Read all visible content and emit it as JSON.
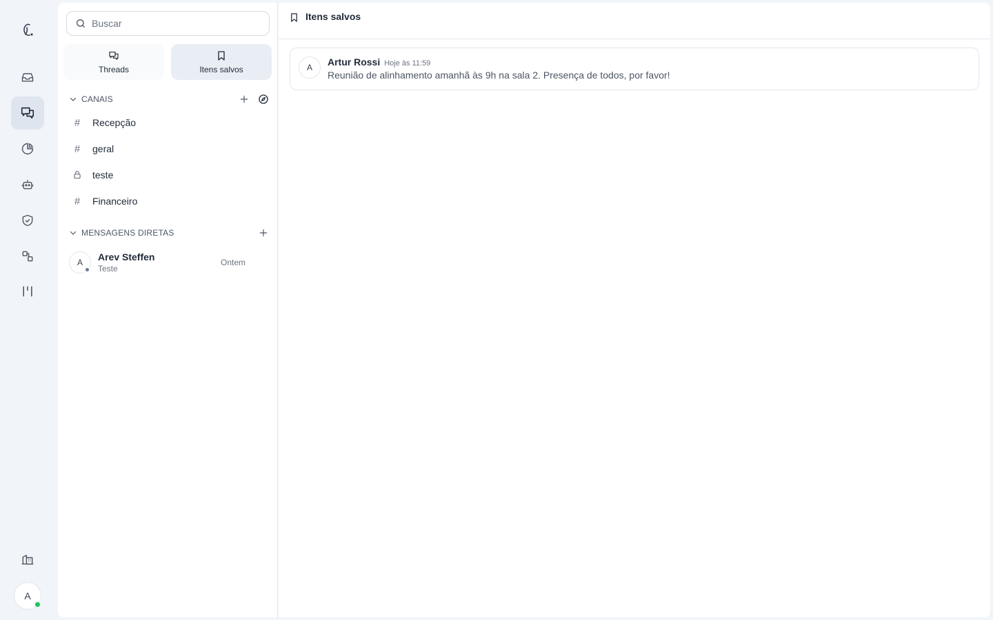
{
  "rail": {
    "items": [
      {
        "name": "logo",
        "icon": "app-logo-icon"
      },
      {
        "name": "inbox",
        "icon": "inbox-icon"
      },
      {
        "name": "chat",
        "icon": "chat-bubbles-icon",
        "active": true
      },
      {
        "name": "reports",
        "icon": "pie-chart-icon"
      },
      {
        "name": "bots",
        "icon": "robot-icon"
      },
      {
        "name": "security",
        "icon": "shield-check-icon"
      },
      {
        "name": "workflows",
        "icon": "workflow-icon"
      },
      {
        "name": "kanban",
        "icon": "kanban-icon"
      },
      {
        "name": "company",
        "icon": "building-icon"
      }
    ],
    "user_initial": "A"
  },
  "sidebar": {
    "search_placeholder": "Buscar",
    "tabs": [
      {
        "label": "Threads",
        "icon": "threads-icon"
      },
      {
        "label": "Itens salvos",
        "icon": "bookmark-icon",
        "active": true
      }
    ],
    "channels_header": "CANAIS",
    "channels": [
      {
        "name": "Recepção",
        "type": "public"
      },
      {
        "name": "geral",
        "type": "public"
      },
      {
        "name": "teste",
        "type": "private"
      },
      {
        "name": "Financeiro",
        "type": "public"
      }
    ],
    "dm_header": "MENSAGENS DIRETAS",
    "dms": [
      {
        "initial": "A",
        "name": "Arev Steffen",
        "preview": "Teste",
        "time": "Ontem"
      }
    ]
  },
  "main": {
    "title": "Itens salvos",
    "saved": [
      {
        "initial": "A",
        "author": "Artur Rossi",
        "time": "Hoje às 11:59",
        "message": "Reunião de alinhamento amanhã às 9h na sala 2. Presença de todos, por favor!"
      }
    ]
  }
}
